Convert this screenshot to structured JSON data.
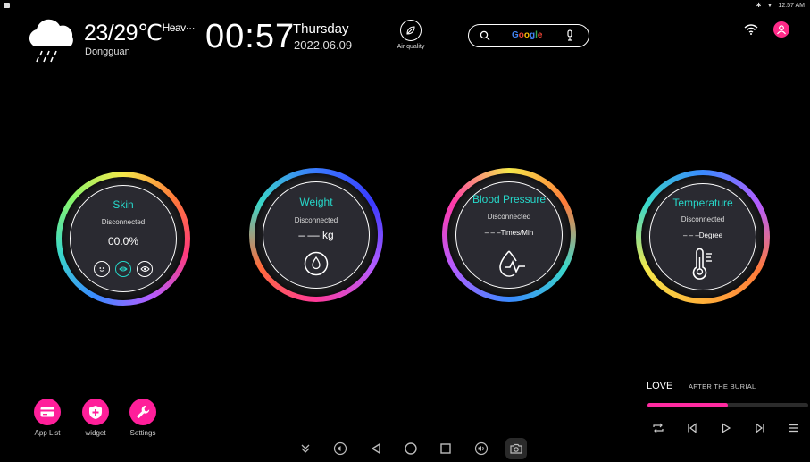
{
  "status_bar": {
    "time": "12:57 AM"
  },
  "weather": {
    "icon": "cloud-rain-icon",
    "temperature": "23/29℃",
    "condition": "Heav···",
    "city": "Dongguan"
  },
  "clock": {
    "time": "00:57",
    "weekday": "Thursday",
    "date": "2022.06.09"
  },
  "air_quality": {
    "label": "Air quality",
    "icon": "leaf-icon"
  },
  "search": {
    "brand": "Google",
    "icons": [
      "search-icon",
      "mic-icon"
    ]
  },
  "gauges": {
    "skin": {
      "title": "Skin",
      "status": "Disconnected",
      "value": "00.0%"
    },
    "weight": {
      "title": "Weight",
      "status": "Disconnected",
      "value": "– –– kg"
    },
    "blood_pressure": {
      "title": "Blood Pressure",
      "status": "Disconnected",
      "value": "– – –Times/Min"
    },
    "temperature": {
      "title": "Temperature",
      "status": "Disconnected",
      "value": "– – –Degree"
    }
  },
  "apps": [
    {
      "label": "App List",
      "icon": "card-icon"
    },
    {
      "label": "widget",
      "icon": "plus-shield-icon"
    },
    {
      "label": "Settings",
      "icon": "wrench-icon"
    }
  ],
  "music": {
    "title": "LOVE",
    "album": "AFTER THE BURIAL",
    "progress": 0.5
  },
  "colors": {
    "accent": "#ff1f9a",
    "teal": "#26d7c9",
    "background": "#000000"
  }
}
